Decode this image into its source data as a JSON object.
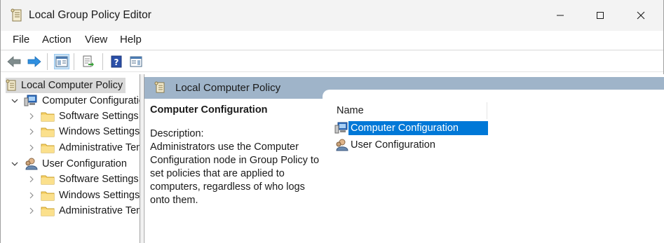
{
  "window": {
    "title": "Local Group Policy Editor"
  },
  "menu": [
    "File",
    "Action",
    "View",
    "Help"
  ],
  "toolbar": {
    "buttons": [
      "back-icon",
      "forward-icon",
      "show-hide-tree-icon",
      "export-list-icon",
      "help-icon",
      "show-action-pane-icon"
    ]
  },
  "tree": {
    "root": "Local Computer Policy",
    "computer_config": {
      "label": "Computer Configuration",
      "children": [
        "Software Settings",
        "Windows Settings",
        "Administrative Templates"
      ]
    },
    "user_config": {
      "label": "User Configuration",
      "children": [
        "Software Settings",
        "Windows Settings",
        "Administrative Templates"
      ]
    }
  },
  "details": {
    "header": "Local Computer Policy",
    "heading": "Computer Configuration",
    "description_label": "Description:",
    "description_text": "Administrators use the Computer Configuration node in Group Policy to set policies that are applied to computers, regardless of who logs onto them."
  },
  "list": {
    "column_name": "Name",
    "items": [
      "Computer Configuration",
      "User Configuration"
    ],
    "selected_index": 0
  },
  "colors": {
    "selection": "#0078d7",
    "header_band": "#9fb4c9",
    "tree_root_highlight": "#d9d9d9"
  }
}
